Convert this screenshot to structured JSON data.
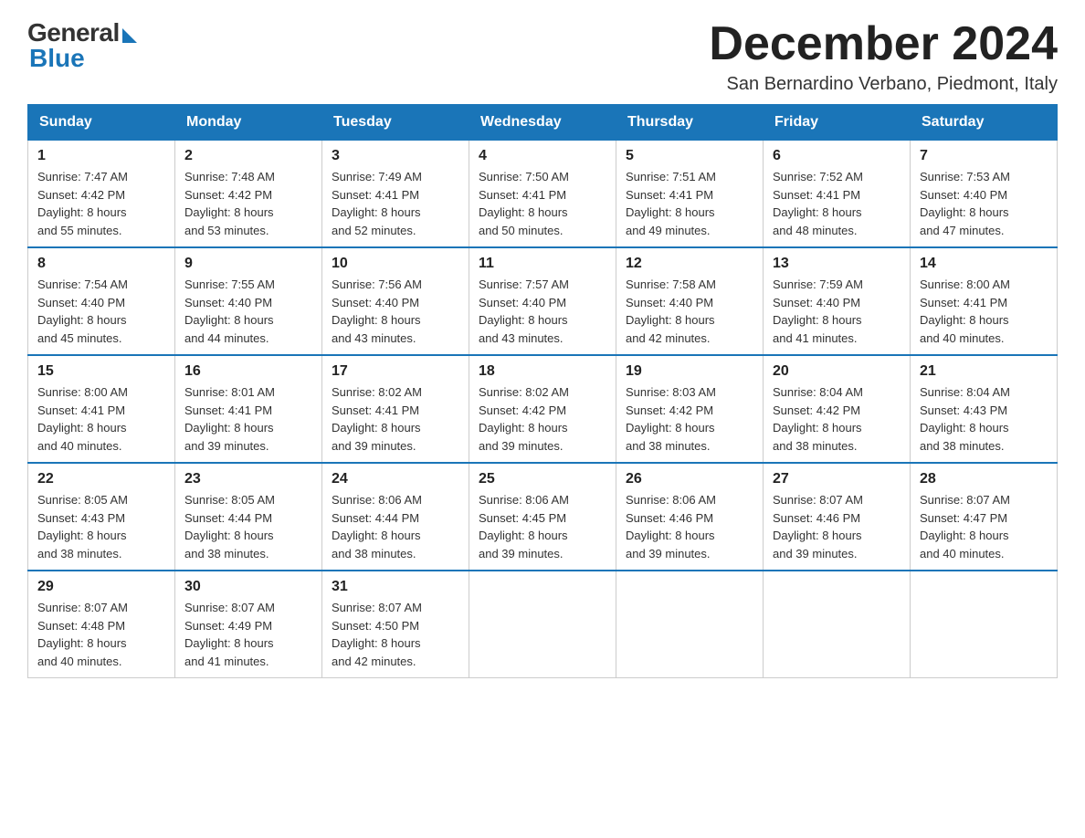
{
  "header": {
    "logo_general": "General",
    "logo_blue": "Blue",
    "month_title": "December 2024",
    "location": "San Bernardino Verbano, Piedmont, Italy"
  },
  "days_of_week": [
    "Sunday",
    "Monday",
    "Tuesday",
    "Wednesday",
    "Thursday",
    "Friday",
    "Saturday"
  ],
  "weeks": [
    [
      {
        "day": "1",
        "sunrise": "7:47 AM",
        "sunset": "4:42 PM",
        "daylight": "8 hours and 55 minutes."
      },
      {
        "day": "2",
        "sunrise": "7:48 AM",
        "sunset": "4:42 PM",
        "daylight": "8 hours and 53 minutes."
      },
      {
        "day": "3",
        "sunrise": "7:49 AM",
        "sunset": "4:41 PM",
        "daylight": "8 hours and 52 minutes."
      },
      {
        "day": "4",
        "sunrise": "7:50 AM",
        "sunset": "4:41 PM",
        "daylight": "8 hours and 50 minutes."
      },
      {
        "day": "5",
        "sunrise": "7:51 AM",
        "sunset": "4:41 PM",
        "daylight": "8 hours and 49 minutes."
      },
      {
        "day": "6",
        "sunrise": "7:52 AM",
        "sunset": "4:41 PM",
        "daylight": "8 hours and 48 minutes."
      },
      {
        "day": "7",
        "sunrise": "7:53 AM",
        "sunset": "4:40 PM",
        "daylight": "8 hours and 47 minutes."
      }
    ],
    [
      {
        "day": "8",
        "sunrise": "7:54 AM",
        "sunset": "4:40 PM",
        "daylight": "8 hours and 45 minutes."
      },
      {
        "day": "9",
        "sunrise": "7:55 AM",
        "sunset": "4:40 PM",
        "daylight": "8 hours and 44 minutes."
      },
      {
        "day": "10",
        "sunrise": "7:56 AM",
        "sunset": "4:40 PM",
        "daylight": "8 hours and 43 minutes."
      },
      {
        "day": "11",
        "sunrise": "7:57 AM",
        "sunset": "4:40 PM",
        "daylight": "8 hours and 43 minutes."
      },
      {
        "day": "12",
        "sunrise": "7:58 AM",
        "sunset": "4:40 PM",
        "daylight": "8 hours and 42 minutes."
      },
      {
        "day": "13",
        "sunrise": "7:59 AM",
        "sunset": "4:40 PM",
        "daylight": "8 hours and 41 minutes."
      },
      {
        "day": "14",
        "sunrise": "8:00 AM",
        "sunset": "4:41 PM",
        "daylight": "8 hours and 40 minutes."
      }
    ],
    [
      {
        "day": "15",
        "sunrise": "8:00 AM",
        "sunset": "4:41 PM",
        "daylight": "8 hours and 40 minutes."
      },
      {
        "day": "16",
        "sunrise": "8:01 AM",
        "sunset": "4:41 PM",
        "daylight": "8 hours and 39 minutes."
      },
      {
        "day": "17",
        "sunrise": "8:02 AM",
        "sunset": "4:41 PM",
        "daylight": "8 hours and 39 minutes."
      },
      {
        "day": "18",
        "sunrise": "8:02 AM",
        "sunset": "4:42 PM",
        "daylight": "8 hours and 39 minutes."
      },
      {
        "day": "19",
        "sunrise": "8:03 AM",
        "sunset": "4:42 PM",
        "daylight": "8 hours and 38 minutes."
      },
      {
        "day": "20",
        "sunrise": "8:04 AM",
        "sunset": "4:42 PM",
        "daylight": "8 hours and 38 minutes."
      },
      {
        "day": "21",
        "sunrise": "8:04 AM",
        "sunset": "4:43 PM",
        "daylight": "8 hours and 38 minutes."
      }
    ],
    [
      {
        "day": "22",
        "sunrise": "8:05 AM",
        "sunset": "4:43 PM",
        "daylight": "8 hours and 38 minutes."
      },
      {
        "day": "23",
        "sunrise": "8:05 AM",
        "sunset": "4:44 PM",
        "daylight": "8 hours and 38 minutes."
      },
      {
        "day": "24",
        "sunrise": "8:06 AM",
        "sunset": "4:44 PM",
        "daylight": "8 hours and 38 minutes."
      },
      {
        "day": "25",
        "sunrise": "8:06 AM",
        "sunset": "4:45 PM",
        "daylight": "8 hours and 39 minutes."
      },
      {
        "day": "26",
        "sunrise": "8:06 AM",
        "sunset": "4:46 PM",
        "daylight": "8 hours and 39 minutes."
      },
      {
        "day": "27",
        "sunrise": "8:07 AM",
        "sunset": "4:46 PM",
        "daylight": "8 hours and 39 minutes."
      },
      {
        "day": "28",
        "sunrise": "8:07 AM",
        "sunset": "4:47 PM",
        "daylight": "8 hours and 40 minutes."
      }
    ],
    [
      {
        "day": "29",
        "sunrise": "8:07 AM",
        "sunset": "4:48 PM",
        "daylight": "8 hours and 40 minutes."
      },
      {
        "day": "30",
        "sunrise": "8:07 AM",
        "sunset": "4:49 PM",
        "daylight": "8 hours and 41 minutes."
      },
      {
        "day": "31",
        "sunrise": "8:07 AM",
        "sunset": "4:50 PM",
        "daylight": "8 hours and 42 minutes."
      },
      null,
      null,
      null,
      null
    ]
  ],
  "labels": {
    "sunrise": "Sunrise:",
    "sunset": "Sunset:",
    "daylight": "Daylight:"
  }
}
